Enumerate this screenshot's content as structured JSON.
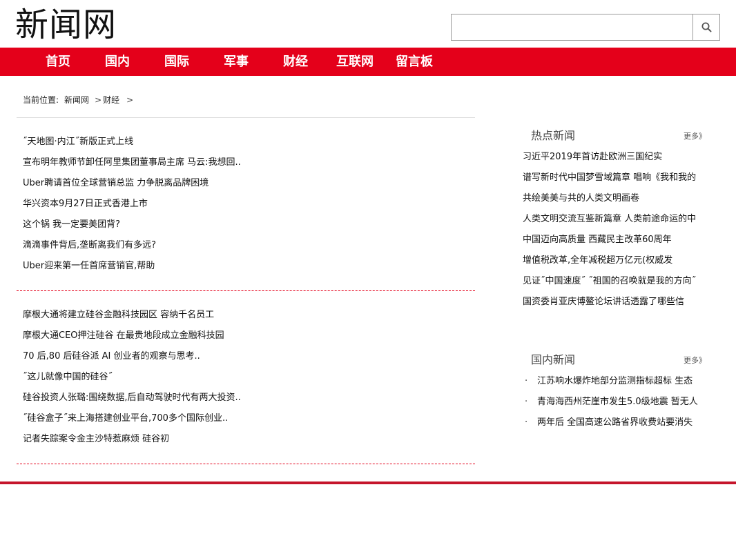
{
  "header": {
    "logo": "新闻网",
    "search": {
      "placeholder": "",
      "value": "",
      "icon": "search-icon"
    }
  },
  "nav": {
    "items": [
      "首页",
      "国内",
      "国际",
      "军事",
      "财经",
      "互联网",
      "留言板"
    ],
    "color": "#e4001a"
  },
  "breadcrumb": {
    "label": "当前位置:",
    "items": [
      "新闻网",
      "财经"
    ],
    "separator": ">"
  },
  "main": {
    "list1": [
      "˝天地图·内江˝新版正式上线",
      "宣布明年教师节卸任阿里集团董事局主席 马云:我想回..",
      "Uber聘请首位全球营销总监 力争脱离品牌困境",
      "华兴资本9月27日正式香港上市",
      "这个锅 我一定要美团背?",
      "滴滴事件背后,垄断离我们有多远?",
      "Uber迎来第一任首席营销官,帮助"
    ],
    "list2": [
      "摩根大通将建立硅谷金融科技园区 容纳千名员工",
      "摩根大通CEO押注硅谷 在最贵地段成立金融科技园",
      "70 后,80 后硅谷派 AI 创业者的观察与思考..",
      "˝这儿就像中国的硅谷˝",
      "硅谷投资人张璐:围绕数据,后自动驾驶时代有两大投资..",
      "˝硅谷盒子˝来上海搭建创业平台,700多个国际创业..",
      "记者失踪案令金主沙特惹麻烦 硅谷初"
    ]
  },
  "sidebar": {
    "hot": {
      "title": "热点新闻",
      "more": "更多》",
      "items": [
        "习近平2019年首访赴欧洲三国纪实",
        "谱写新时代中国梦雪域篇章 唱响《我和我的",
        "共绘美美与共的人类文明画卷",
        "人类文明交流互鉴新篇章 人类前途命运的中",
        "中国迈向高质量 西藏民主改革60周年",
        "增值税改革,全年减税超万亿元(权威发",
        "见证˝中国速度˝ ˝祖国的召唤就是我的方向˝",
        "国资委肖亚庆博鳌论坛讲话透露了哪些信"
      ]
    },
    "domestic": {
      "title": "国内新闻",
      "more": "更多》",
      "bullet": "·",
      "items": [
        "江苏响水爆炸地部分监测指标超标 生态",
        "青海海西州茫崖市发生5.0级地震 暂无人",
        "两年后 全国高速公路省界收费站要消失"
      ]
    }
  },
  "colors": {
    "accent": "#e4001a",
    "footer_rule": "#c5152b"
  }
}
